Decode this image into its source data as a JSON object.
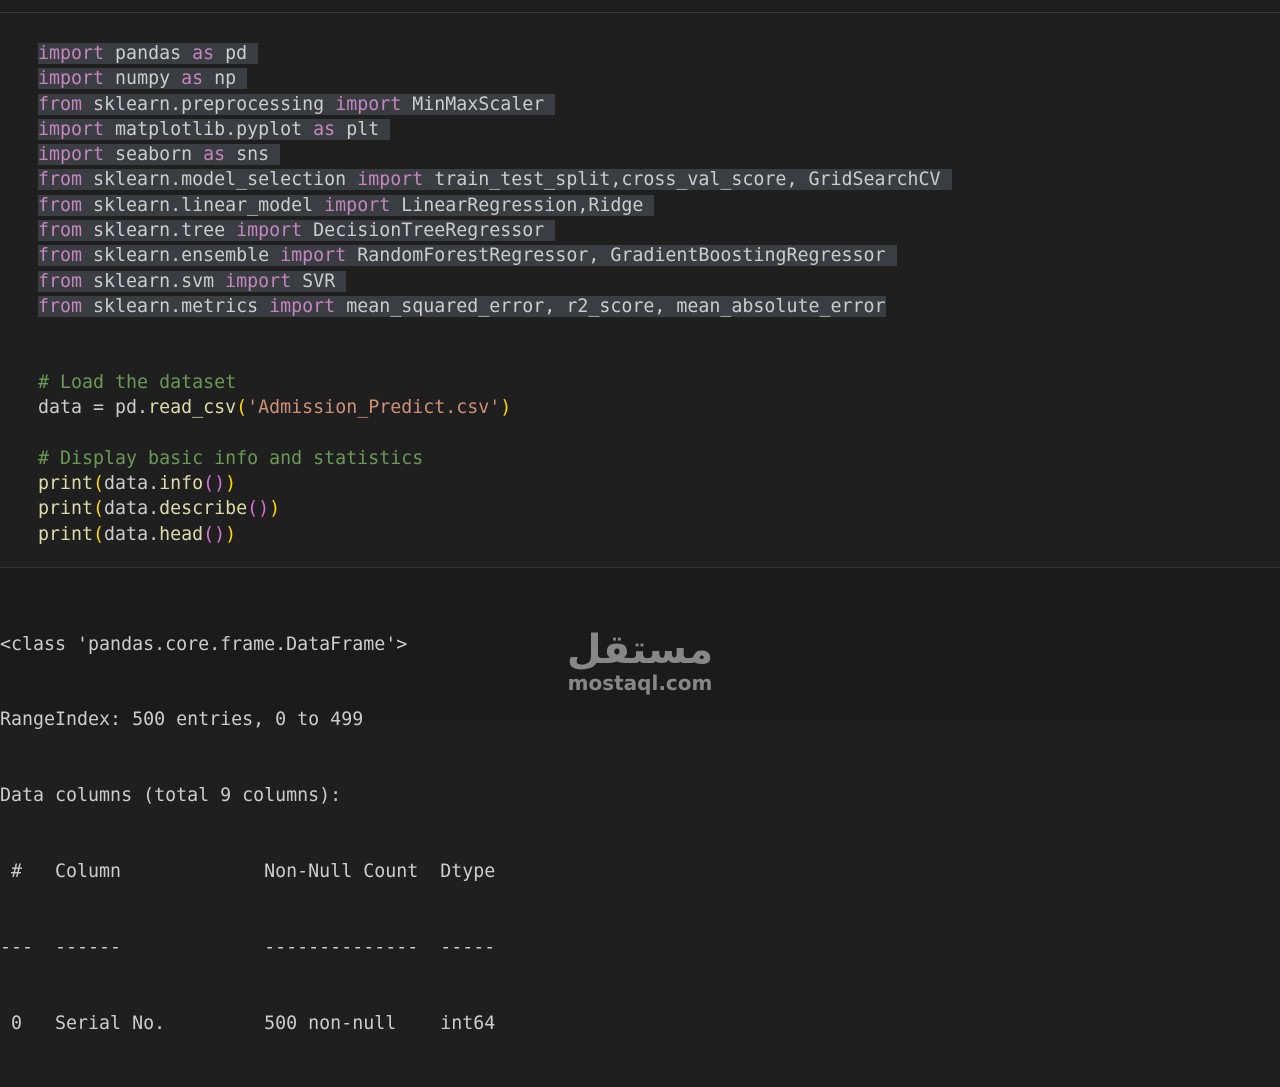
{
  "editor": {
    "imports": [
      {
        "kw1": "import",
        "mod": " pandas ",
        "kw2": "as",
        "rest": " pd"
      },
      {
        "kw1": "import",
        "mod": " numpy ",
        "kw2": "as",
        "rest": " np"
      },
      {
        "kw1": "from",
        "mod": " sklearn.preprocessing ",
        "kw2": "import",
        "rest": " MinMaxScaler"
      },
      {
        "kw1": "import",
        "mod": " matplotlib.pyplot ",
        "kw2": "as",
        "rest": " plt"
      },
      {
        "kw1": "import",
        "mod": " seaborn ",
        "kw2": "as",
        "rest": " sns"
      },
      {
        "kw1": "from",
        "mod": " sklearn.model_selection ",
        "kw2": "import",
        "rest": " train_test_split,cross_val_score, GridSearchCV"
      },
      {
        "kw1": "from",
        "mod": " sklearn.linear_model ",
        "kw2": "import",
        "rest": " LinearRegression,Ridge"
      },
      {
        "kw1": "from",
        "mod": " sklearn.tree ",
        "kw2": "import",
        "rest": " DecisionTreeRegressor"
      },
      {
        "kw1": "from",
        "mod": " sklearn.ensemble ",
        "kw2": "import",
        "rest": " RandomForestRegressor, GradientBoostingRegressor"
      },
      {
        "kw1": "from",
        "mod": " sklearn.svm ",
        "kw2": "import",
        "rest": " SVR"
      },
      {
        "kw1": "from",
        "mod": " sklearn.metrics ",
        "kw2": "import",
        "rest": " mean_squared_error, r2_score, mean_absolute_error"
      }
    ],
    "comment_load": "# Load the dataset",
    "load": {
      "prefix": "data = pd.",
      "fn": "read_csv",
      "open": "(",
      "arg": "'Admission_Predict.csv'",
      "close": ")"
    },
    "comment_display": "# Display basic info and statistics",
    "prints": [
      {
        "fn": "print",
        "open": "(",
        "obj": "data.",
        "method": "info",
        "inner": "()",
        "close": ")"
      },
      {
        "fn": "print",
        "open": "(",
        "obj": "data.",
        "method": "describe",
        "inner": "()",
        "close": ")"
      },
      {
        "fn": "print",
        "open": "(",
        "obj": "data.",
        "method": "head",
        "inner": "()",
        "close": ")"
      }
    ]
  },
  "output": {
    "lines": [
      "<class 'pandas.core.frame.DataFrame'>",
      "RangeIndex: 500 entries, 0 to 499",
      "Data columns (total 9 columns):",
      " #   Column             Non-Null Count  Dtype",
      "---  ------             --------------  -----",
      " 0   Serial No.         500 non-null    int64"
    ]
  },
  "watermark": {
    "arabic": "مستقل",
    "latin": "mostaql.com"
  },
  "colors": {
    "background": "#1f1f1f",
    "keyword": "#c586c0",
    "comment": "#6a9955",
    "string": "#ce9178",
    "function": "#dcdcaa",
    "bracket": "#ffd700",
    "selection": "#3a3d41"
  }
}
